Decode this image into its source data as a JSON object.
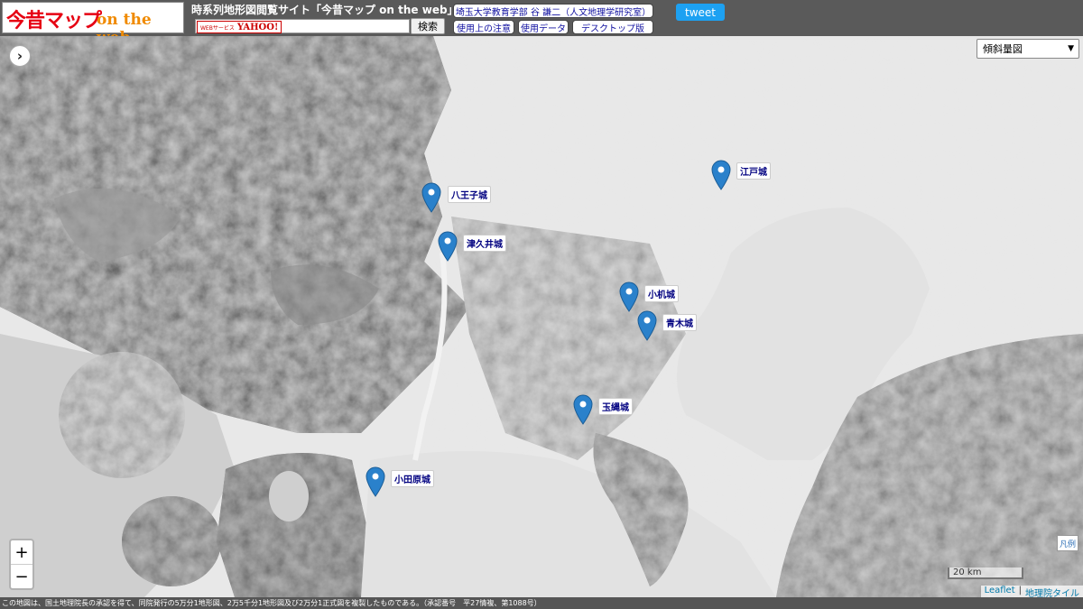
{
  "header": {
    "logo_jp": "今昔マップ",
    "logo_en": "on the web",
    "site_title": "時系列地形図閲覧サイト「今昔マップ on the web」",
    "search": {
      "badge_small": "WEBサービス",
      "badge_logo": "YAHOO!",
      "value": "",
      "button_label": "検索"
    },
    "nav": {
      "author": "埼玉大学教育学部 谷 謙二（人文地理学研究室）",
      "notes": "使用上の注意",
      "data": "使用データ",
      "desktop": "デスクトップ版"
    },
    "tweet_label": "tweet"
  },
  "map": {
    "layer_select": "傾斜量図",
    "sidebar_toggle_icon": "chevron-right-icon",
    "zoom_in": "+",
    "zoom_out": "−",
    "legend_label": "凡例",
    "scale_label": "20 km",
    "attribution": {
      "leaflet": "Leaflet",
      "separator": "|",
      "gsi": "地理院タイル"
    },
    "castles": [
      {
        "name": "江戸城"
      },
      {
        "name": "八王子城"
      },
      {
        "name": "津久井城"
      },
      {
        "name": "小机城"
      },
      {
        "name": "青木城"
      },
      {
        "name": "玉縄城"
      },
      {
        "name": "小田原城"
      }
    ],
    "pin_color": "#2a81cb"
  },
  "footer": {
    "text": "この地図は、国土地理院長の承認を得て、同院発行の5万分1地形図、2万5千分1地形図及び2万分1正式図を複製したものである。（承認番号　平27情複、第1088号）"
  }
}
